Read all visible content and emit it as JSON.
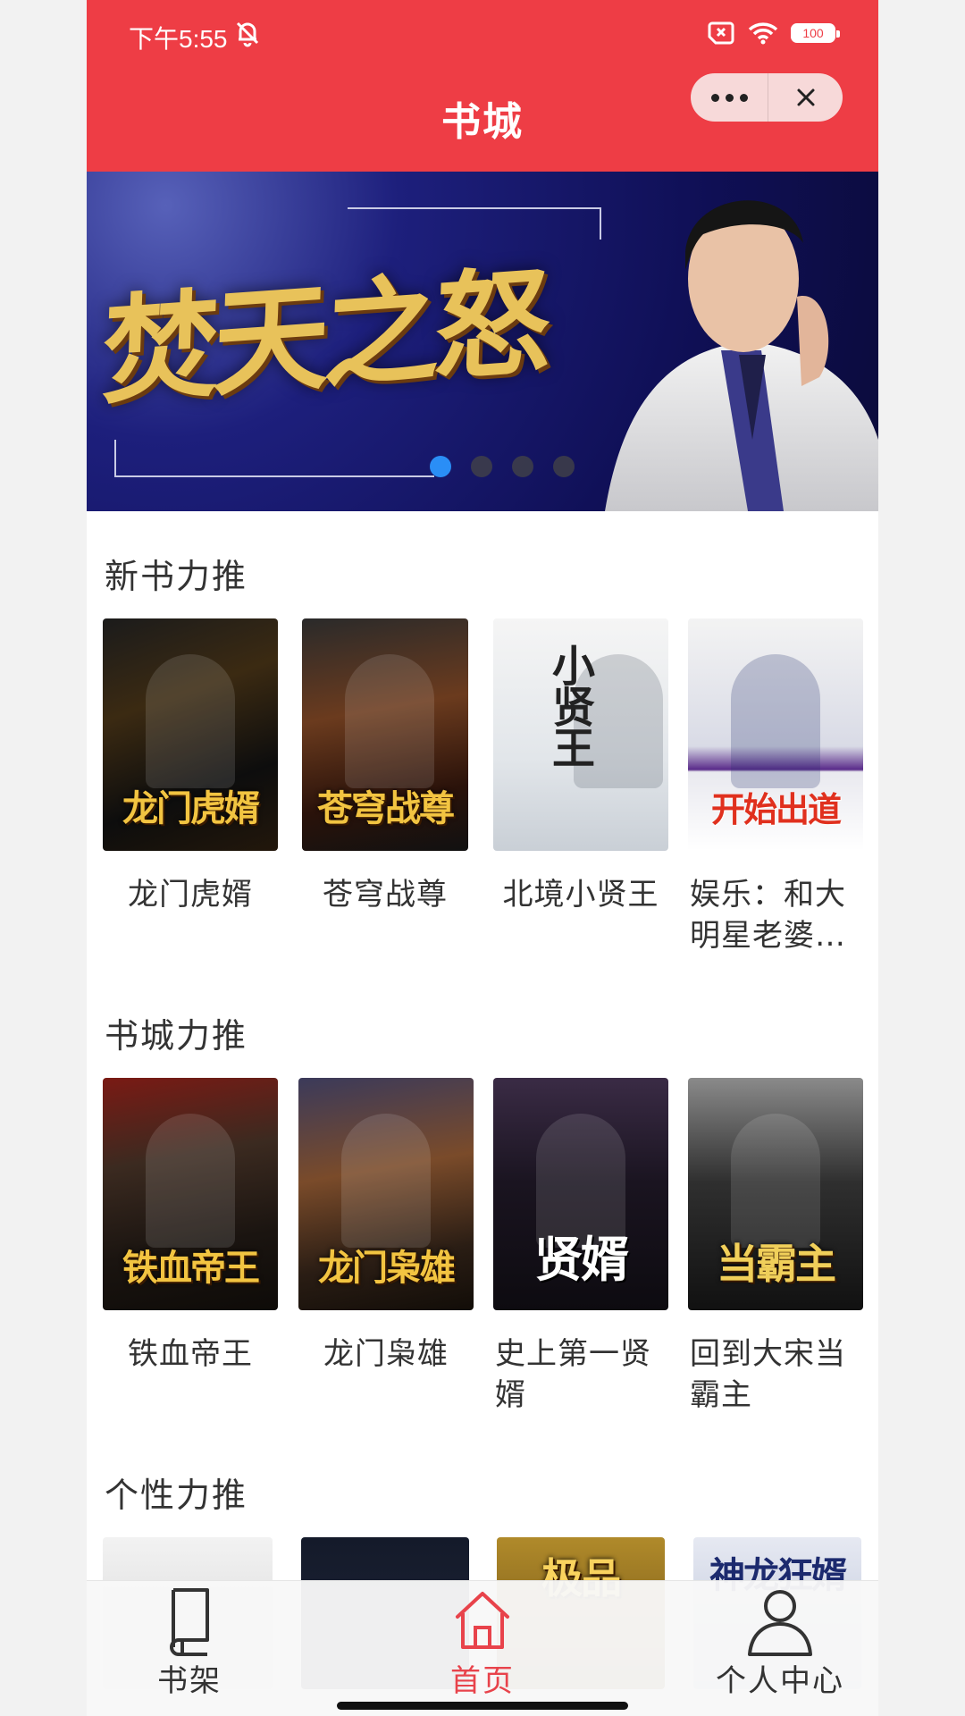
{
  "status_bar": {
    "time": "下午5:55",
    "battery": "100",
    "icons": [
      "bell-off-icon",
      "sim-off-icon",
      "wifi-icon",
      "battery-icon"
    ]
  },
  "header": {
    "title": "书城",
    "more_icon": "more-dots-icon",
    "close_icon": "close-icon",
    "background_color": "#ee3d45"
  },
  "banner": {
    "title": "焚天之怒",
    "page_count": 4,
    "active_page": 1
  },
  "sections": [
    {
      "title": "新书力推",
      "books": [
        {
          "title": "龙门虎婿",
          "cover_text": "龙门虎婿"
        },
        {
          "title": "苍穹战尊",
          "cover_text": "苍穹战尊"
        },
        {
          "title": "北境小贤王",
          "cover_text": "小贤王"
        },
        {
          "title": "娱乐：和大明星老婆…",
          "cover_text": "开始出道"
        }
      ]
    },
    {
      "title": "书城力推",
      "books": [
        {
          "title": "铁血帝王",
          "cover_text": "铁血帝王"
        },
        {
          "title": "龙门枭雄",
          "cover_text": "龙门枭雄"
        },
        {
          "title": "史上第一贤婿",
          "cover_text": "贤婿"
        },
        {
          "title": "回到大宋当霸主",
          "cover_text": "当霸主"
        }
      ]
    },
    {
      "title": "个性力推",
      "books": [
        {
          "cover_text": ""
        },
        {
          "cover_text": ""
        },
        {
          "cover_text": "极品"
        },
        {
          "cover_text": "神龙狂婿"
        }
      ]
    }
  ],
  "tabbar": {
    "items": [
      {
        "label": "书架",
        "icon": "bookshelf-icon"
      },
      {
        "label": "首页",
        "icon": "home-icon",
        "active": true
      },
      {
        "label": "个人中心",
        "icon": "user-icon"
      }
    ],
    "active_color": "#e8434b"
  }
}
